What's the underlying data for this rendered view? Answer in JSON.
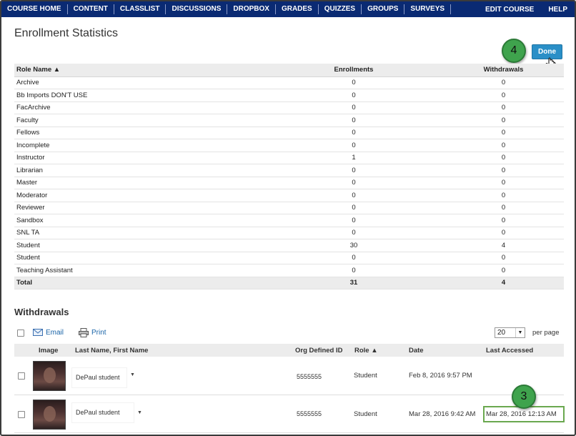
{
  "nav": {
    "items": [
      "COURSE HOME",
      "CONTENT",
      "CLASSLIST",
      "DISCUSSIONS",
      "DROPBOX",
      "GRADES",
      "QUIZZES",
      "GROUPS",
      "SURVEYS"
    ],
    "right_items": [
      "EDIT COURSE",
      "HELP"
    ]
  },
  "page_title": "Enrollment Statistics",
  "done_label": "Done",
  "callouts": {
    "done": "4",
    "last_accessed": "3"
  },
  "stats": {
    "headers": [
      "Role Name ▲",
      "Enrollments",
      "Withdrawals"
    ],
    "rows": [
      [
        "Archive",
        "0",
        "0"
      ],
      [
        "Bb Imports DON'T USE",
        "0",
        "0"
      ],
      [
        "FacArchive",
        "0",
        "0"
      ],
      [
        "Faculty",
        "0",
        "0"
      ],
      [
        "Fellows",
        "0",
        "0"
      ],
      [
        "Incomplete",
        "0",
        "0"
      ],
      [
        "Instructor",
        "1",
        "0"
      ],
      [
        "Librarian",
        "0",
        "0"
      ],
      [
        "Master",
        "0",
        "0"
      ],
      [
        "Moderator",
        "0",
        "0"
      ],
      [
        "Reviewer",
        "0",
        "0"
      ],
      [
        "Sandbox",
        "0",
        "0"
      ],
      [
        "SNL TA",
        "0",
        "0"
      ],
      [
        "Student",
        "30",
        "4"
      ],
      [
        "Student",
        "0",
        "0"
      ],
      [
        "Teaching Assistant",
        "0",
        "0"
      ]
    ],
    "total": [
      "Total",
      "31",
      "4"
    ]
  },
  "withdrawals": {
    "title": "Withdrawals",
    "toolbar": {
      "email": "Email",
      "print": "Print",
      "per_page_value": "20",
      "per_page_label": "per page"
    },
    "headers": [
      "Image",
      "Last Name, First Name",
      "Org Defined ID",
      "Role ▲",
      "Date",
      "Last Accessed"
    ],
    "rows": [
      {
        "name": "DePaul student",
        "org_id": "5555555",
        "role": "Student",
        "date": "Feb 8, 2016 9:57 PM",
        "last_accessed": ""
      },
      {
        "name": "DePaul student",
        "org_id": "5555555",
        "role": "Student",
        "date": "Mar 28, 2016 9:42 AM",
        "last_accessed": "Mar 28, 2016 12:13 AM"
      }
    ]
  }
}
